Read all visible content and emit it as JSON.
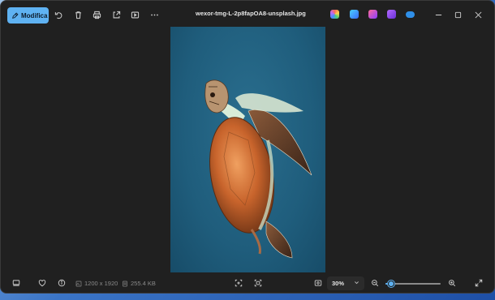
{
  "titlebar": {
    "edit_label": "Modifica",
    "file_name": "wexor-tmg-L-2p8fapOA8-unsplash.jpg",
    "tools": [
      "rotate-icon",
      "delete-icon",
      "print-icon",
      "share-icon",
      "slideshow-icon",
      "more-icon"
    ],
    "apps": [
      {
        "name": "copilot-icon",
        "color": "#6b7bff"
      },
      {
        "name": "designer-icon",
        "color": "#4a8cff"
      },
      {
        "name": "clipchamp-icon",
        "color": "#c04bd8"
      },
      {
        "name": "clipchamp-video-icon",
        "color": "#7a46e0"
      },
      {
        "name": "onedrive-icon",
        "color": "#2f8fe8"
      }
    ],
    "window_controls": [
      "minimize-icon",
      "maximize-icon",
      "close-icon"
    ]
  },
  "status": {
    "dimensions": "1200 x 1920",
    "file_size": "255.4 KB",
    "zoom": "30%",
    "zoom_level": 0.1
  },
  "colors": {
    "accent": "#5fb2f2",
    "background": "#202020"
  }
}
